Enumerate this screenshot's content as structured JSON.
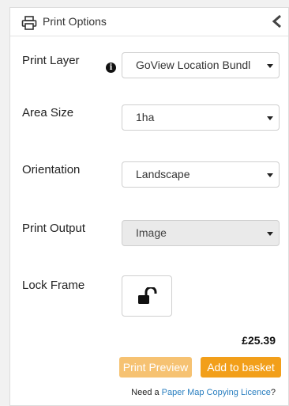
{
  "header": {
    "title": "Print Options",
    "icon": "printer-icon",
    "collapse_icon": "chevron-left-icon"
  },
  "form": {
    "print_layer": {
      "label": "Print Layer",
      "value": "GoView Location Bundl",
      "info_icon": "info-icon"
    },
    "area_size": {
      "label": "Area Size",
      "value": "1ha"
    },
    "orientation": {
      "label": "Orientation",
      "value": "Landscape"
    },
    "print_output": {
      "label": "Print Output",
      "value": "Image",
      "disabled": true
    },
    "lock_frame": {
      "label": "Lock Frame",
      "icon": "unlocked-padlock-icon"
    }
  },
  "price": "£25.39",
  "buttons": {
    "preview": "Print Preview",
    "basket": "Add to basket"
  },
  "licence": {
    "prefix": "Need a ",
    "link": "Paper Map Copying Licence",
    "suffix": "?"
  },
  "colors": {
    "accent": "#f29f1a",
    "accent_light": "#f6c272",
    "link": "#2a7fc0"
  }
}
